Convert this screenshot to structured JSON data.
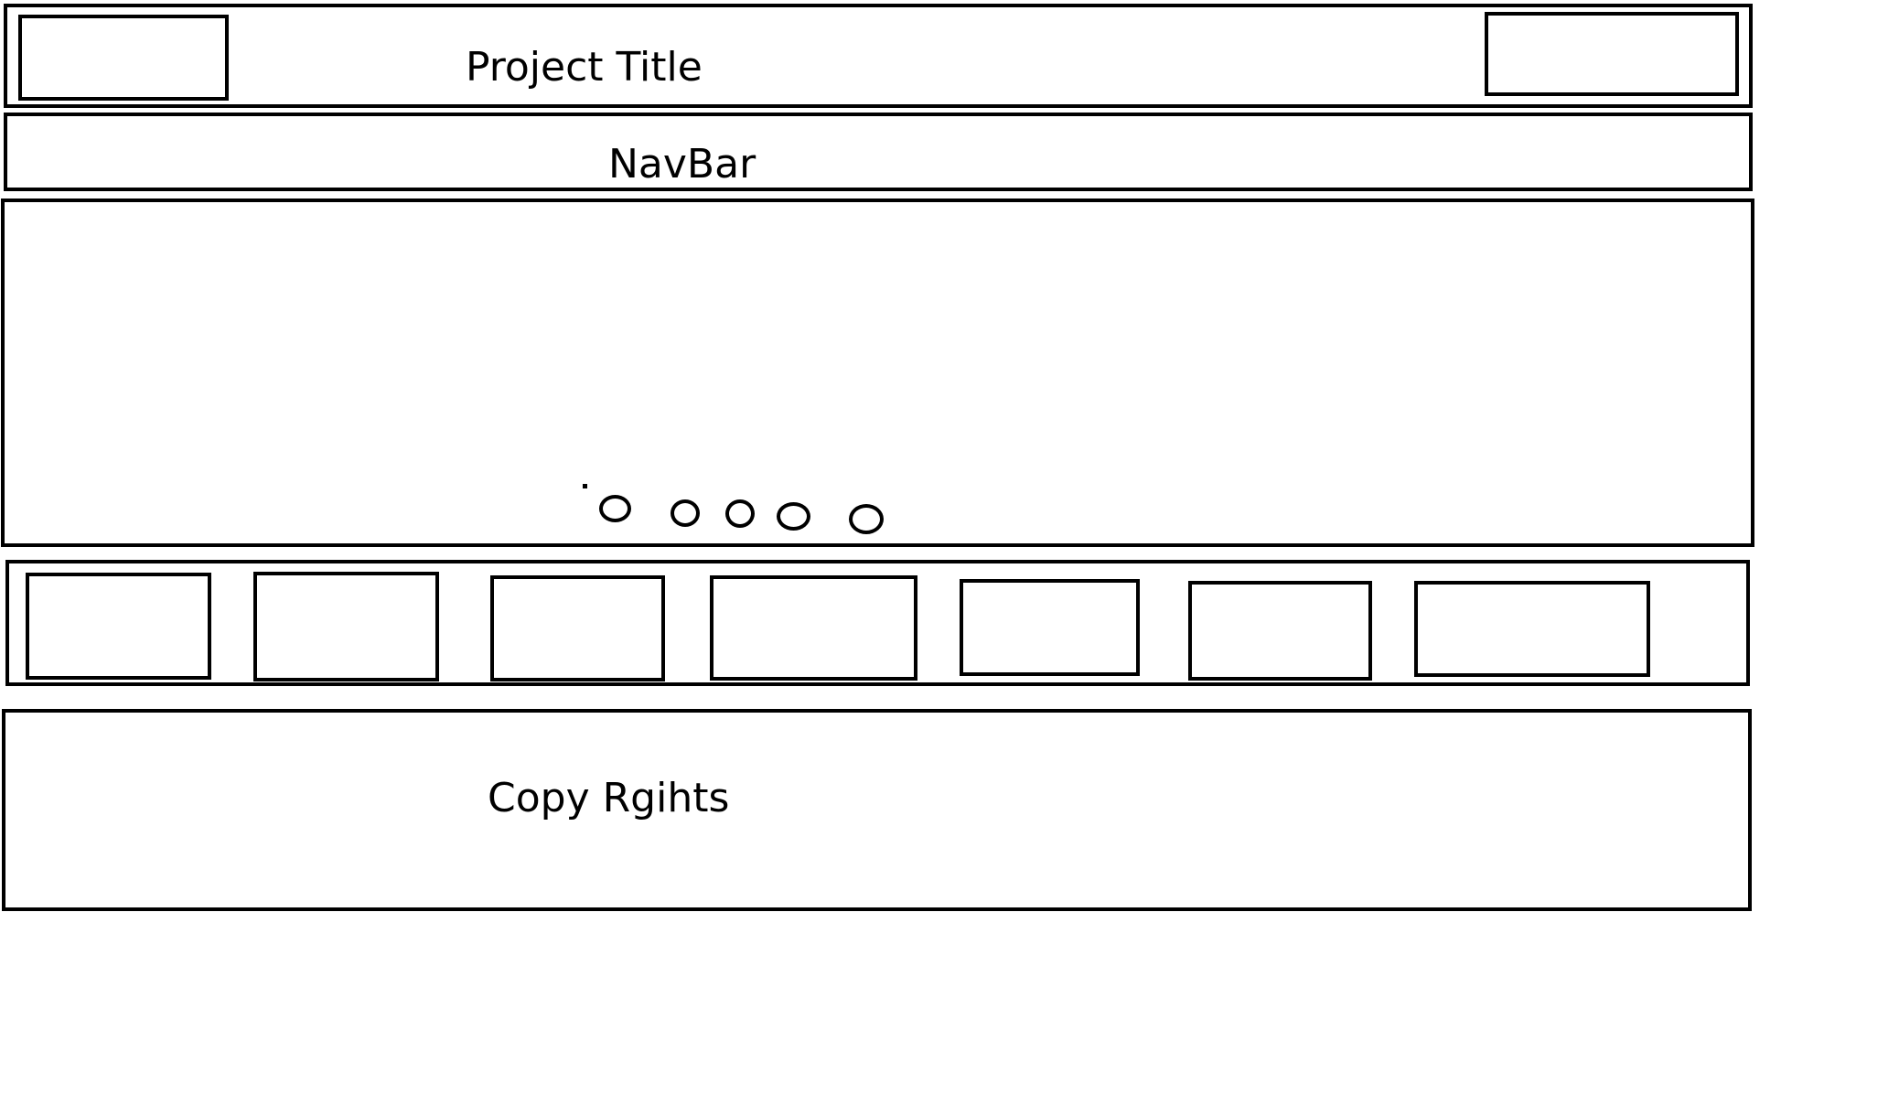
{
  "header": {
    "title": "Project Title"
  },
  "navbar": {
    "label": "NavBar"
  },
  "carousel": {
    "indicator_count": 5,
    "active_index": 0
  },
  "thumbnails": {
    "count": 7
  },
  "footer": {
    "text": "Copy Rgihts"
  }
}
